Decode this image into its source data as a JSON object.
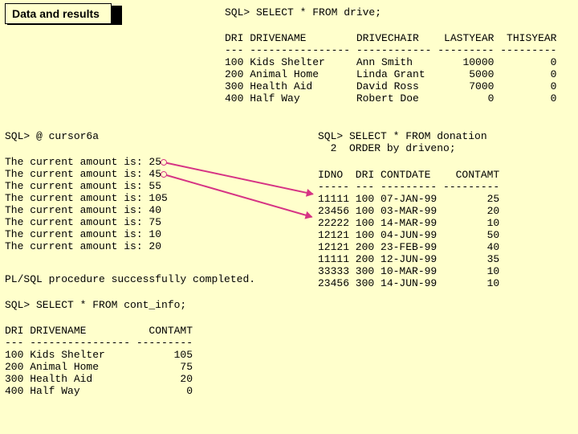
{
  "badge": "Data and results",
  "q1": "SQL> SELECT * FROM drive;",
  "t1": "DRI DRIVENAME        DRIVECHAIR    LASTYEAR  THISYEAR\n--- ---------------- ------------ --------- ---------\n100 Kids Shelter     Ann Smith        10000         0\n200 Animal Home      Linda Grant       5000         0\n300 Health Aid       David Ross        7000         0\n400 Half Way         Robert Doe           0         0",
  "q2": "SQL> @ cursor6a",
  "cur": "The current amount is: 25\nThe current amount is: 45\nThe current amount is: 55\nThe current amount is: 105\nThe current amount is: 40\nThe current amount is: 75\nThe current amount is: 10\nThe current amount is: 20",
  "done": "PL/SQL procedure successfully completed.",
  "q3": "SQL> SELECT * FROM cont_info;",
  "t3": "DRI DRIVENAME          CONTAMT\n--- ---------------- ---------\n100 Kids Shelter           105\n200 Animal Home             75\n300 Health Aid              20\n400 Half Way                 0",
  "q4": "SQL> SELECT * FROM donation\n  2  ORDER by driveno;",
  "t4": "IDNO  DRI CONTDATE    CONTAMT\n----- --- --------- ---------\n11111 100 07-JAN-99        25\n23456 100 03-MAR-99        20\n22222 100 14-MAR-99        10\n12121 100 04-JUN-99        50\n12121 200 23-FEB-99        40\n11111 200 12-JUN-99        35\n33333 300 10-MAR-99        10\n23456 300 14-JUN-99        10"
}
